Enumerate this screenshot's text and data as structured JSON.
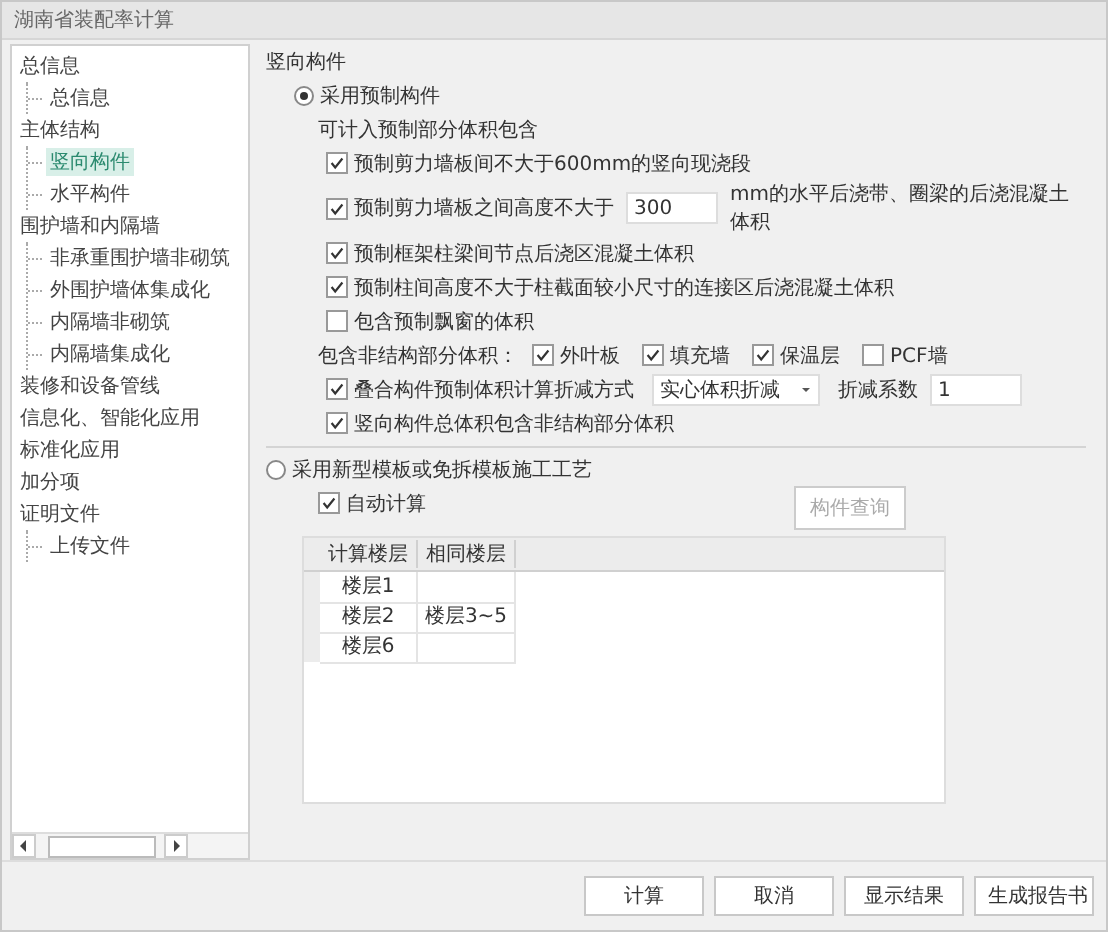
{
  "window": {
    "title": "湖南省装配率计算"
  },
  "sidebar": {
    "items": [
      {
        "label": "总信息",
        "selected": false,
        "children": [
          {
            "label": "总信息",
            "selected": false
          }
        ]
      },
      {
        "label": "主体结构",
        "selected": false,
        "children": [
          {
            "label": "竖向构件",
            "selected": true
          },
          {
            "label": "水平构件",
            "selected": false
          }
        ]
      },
      {
        "label": "围护墙和内隔墙",
        "selected": false,
        "children": [
          {
            "label": "非承重围护墙非砌筑",
            "selected": false
          },
          {
            "label": "外围护墙体集成化",
            "selected": false
          },
          {
            "label": "内隔墙非砌筑",
            "selected": false
          },
          {
            "label": "内隔墙集成化",
            "selected": false
          }
        ]
      },
      {
        "label": "装修和设备管线",
        "selected": false
      },
      {
        "label": "信息化、智能化应用",
        "selected": false
      },
      {
        "label": "标准化应用",
        "selected": false
      },
      {
        "label": "加分项",
        "selected": false
      },
      {
        "label": "证明文件",
        "selected": false,
        "children": [
          {
            "label": "上传文件",
            "selected": false
          }
        ]
      }
    ]
  },
  "section_title": "竖向构件",
  "precast_mode": {
    "label": "采用预制构件",
    "selected": true,
    "caption": "可计入预制部分体积包含",
    "items": [
      {
        "kind": "check",
        "label": "预制剪力墙板间不大于600mm的竖向现浇段",
        "checked": true
      },
      {
        "kind": "check_input",
        "label": "预制剪力墙板之间高度不大于",
        "value": "300",
        "suffix": "mm的水平后浇带、圈梁的后浇混凝土体积",
        "checked": true
      },
      {
        "kind": "check",
        "label": "预制框架柱梁间节点后浇区混凝土体积",
        "checked": true
      },
      {
        "kind": "check",
        "label": "预制柱间高度不大于柱截面较小尺寸的连接区后浇混凝土体积",
        "checked": true
      },
      {
        "kind": "check",
        "label": "包含预制飘窗的体积",
        "checked": false
      }
    ],
    "nonstructural": {
      "label": "包含非结构部分体积：",
      "options": [
        {
          "label": "外叶板",
          "checked": true
        },
        {
          "label": "填充墙",
          "checked": true
        },
        {
          "label": "保温层",
          "checked": true
        },
        {
          "label": "PCF墙",
          "checked": false
        }
      ]
    },
    "reduction": {
      "label": "叠合构件预制体积计算折减方式",
      "checked": true,
      "dropdown": "实心体积折减",
      "coef_label": "折减系数",
      "coef_value": "1"
    },
    "total": {
      "label": "竖向构件总体积包含非结构部分体积",
      "checked": true
    }
  },
  "formwork_mode": {
    "label": "采用新型模板或免拆模板施工工艺",
    "selected": false,
    "auto_calc": {
      "label": "自动计算",
      "checked": true
    },
    "query_button": {
      "label": "构件查询",
      "disabled": true
    },
    "table": {
      "columns": [
        "计算楼层",
        "相同楼层"
      ],
      "rows": [
        {
          "floor": "楼层1"
        },
        {
          "floor": "楼层2",
          "same": "楼层3~5"
        },
        {
          "floor": "楼层6"
        }
      ]
    }
  },
  "buttons": [
    "计算",
    "取消",
    "显示结果",
    "生成报告书"
  ]
}
